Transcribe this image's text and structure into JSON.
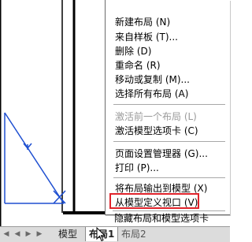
{
  "context_menu": {
    "items": [
      {
        "label": "新建布局 (N)",
        "enabled": true
      },
      {
        "label": "来自样板 (T)...",
        "enabled": true
      },
      {
        "label": "删除 (D)",
        "enabled": true
      },
      {
        "label": "重命名 (R)",
        "enabled": true
      },
      {
        "label": "移动或复制 (M)...",
        "enabled": true
      },
      {
        "label": "选择所有布局 (A)",
        "enabled": true
      },
      {
        "label": "激活前一个布局 (L)",
        "enabled": false
      },
      {
        "label": "激活模型选项卡 (C)",
        "enabled": true
      },
      {
        "label": "页面设置管理器 (G)...",
        "enabled": true
      },
      {
        "label": "打印 (P)...",
        "enabled": true
      },
      {
        "label": "将布局输出到模型 (X)",
        "enabled": true
      },
      {
        "label": "从模型定义视口 (V)",
        "enabled": true,
        "highlighted": true
      },
      {
        "label": "隐藏布局和模型选项卡",
        "enabled": true
      }
    ],
    "highlight_color": "#e0242c"
  },
  "tabs": [
    {
      "label": "模型",
      "active": false
    },
    {
      "label": "布局1",
      "active": true
    },
    {
      "label": "布局2",
      "active": false
    }
  ],
  "icons": {
    "nav_first": "first-tab-icon",
    "nav_prev": "prev-tab-icon",
    "nav_next": "next-tab-icon",
    "nav_last": "last-tab-icon",
    "cursor": "mouse-cursor-icon"
  }
}
